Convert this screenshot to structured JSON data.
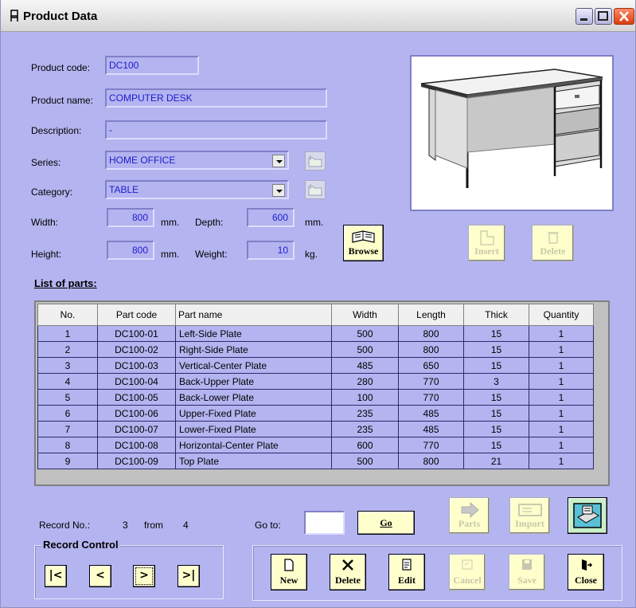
{
  "window": {
    "title": "Product Data"
  },
  "form": {
    "product_code_label": "Product code:",
    "product_code": "DC100",
    "product_name_label": "Product name:",
    "product_name": "COMPUTER DESK",
    "description_label": "Description:",
    "description": "-",
    "series_label": "Series:",
    "series": "HOME OFFICE",
    "category_label": "Category:",
    "category": "TABLE",
    "width_label": "Width:",
    "width": "800",
    "width_unit": "mm.",
    "depth_label": "Depth:",
    "depth": "600",
    "depth_unit": "mm.",
    "height_label": "Height:",
    "height": "800",
    "height_unit": "mm.",
    "weight_label": "Weight:",
    "weight": "10",
    "weight_unit": "kg."
  },
  "buttons": {
    "browse": "Browse",
    "insert": "Insert",
    "delete_image": "Delete",
    "go": "Go",
    "parts": "Parts",
    "import": "Import",
    "new": "New",
    "delete": "Delete",
    "edit": "Edit",
    "cancel": "Cancel",
    "save": "Save",
    "close": "Close"
  },
  "parts": {
    "heading": "List of parts:",
    "columns": [
      "No.",
      "Part code",
      "Part name",
      "Width",
      "Length",
      "Thick",
      "Quantity"
    ],
    "rows": [
      [
        "1",
        "DC100-01",
        "Left-Side Plate",
        "500",
        "800",
        "15",
        "1"
      ],
      [
        "2",
        "DC100-02",
        "Right-Side Plate",
        "500",
        "800",
        "15",
        "1"
      ],
      [
        "3",
        "DC100-03",
        "Vertical-Center Plate",
        "485",
        "650",
        "15",
        "1"
      ],
      [
        "4",
        "DC100-04",
        "Back-Upper Plate",
        "280",
        "770",
        "3",
        "1"
      ],
      [
        "5",
        "DC100-05",
        "Back-Lower Plate",
        "100",
        "770",
        "15",
        "1"
      ],
      [
        "6",
        "DC100-06",
        "Upper-Fixed Plate",
        "235",
        "485",
        "15",
        "1"
      ],
      [
        "7",
        "DC100-07",
        "Lower-Fixed Plate",
        "235",
        "485",
        "15",
        "1"
      ],
      [
        "8",
        "DC100-08",
        "Horizontal-Center Plate",
        "600",
        "770",
        "15",
        "1"
      ],
      [
        "9",
        "DC100-09",
        "Top Plate",
        "500",
        "800",
        "21",
        "1"
      ]
    ]
  },
  "record": {
    "label": "Record No.:",
    "current": "3",
    "from_label": "from",
    "total": "4",
    "goto_label": "Go to:",
    "goto_value": ""
  },
  "record_control": {
    "title": "Record Control",
    "first": "|<",
    "prev": "<",
    "next": ">",
    "last": ">|"
  },
  "colors": {
    "background": "#b4b4f0",
    "field_text": "#1c1cd0",
    "button_face": "#ffffcc"
  }
}
